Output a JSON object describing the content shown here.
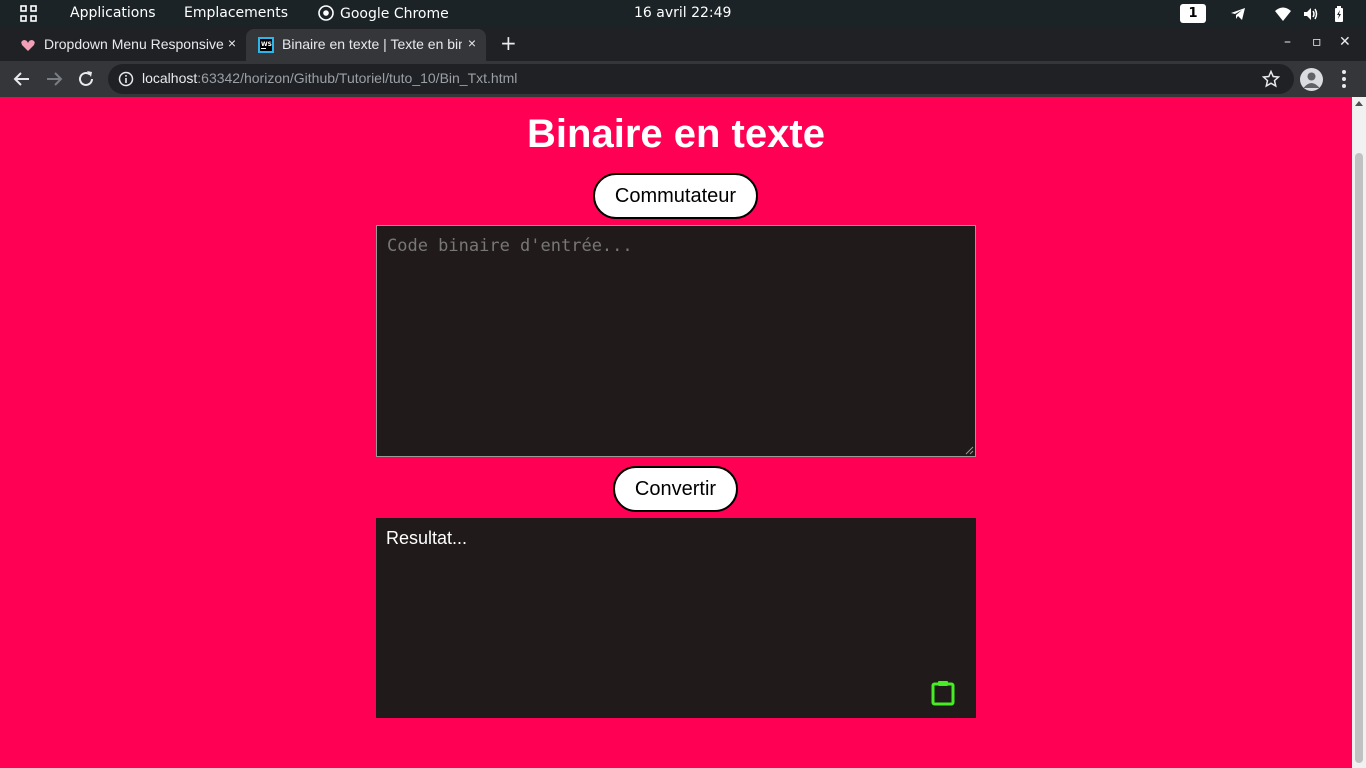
{
  "topbar": {
    "applications": "Applications",
    "places": "Emplacements",
    "active_app": "Google Chrome",
    "datetime": "16 avril  22:49",
    "workspace": "1"
  },
  "tabs": [
    {
      "title": "Dropdown Menu Responsive",
      "close": "×",
      "favicon": "heart-icon"
    },
    {
      "title": "Binaire en texte | Texte en binaire",
      "close": "×",
      "favicon": "webstorm-icon"
    }
  ],
  "new_tab": "+",
  "window_controls": {
    "minimize": "–",
    "maximize": "▫",
    "close": "✕"
  },
  "address_bar": {
    "host": "localhost",
    "path": ":63342/horizon/Github/Tutoriel/tuto_10/Bin_Txt.html"
  },
  "page": {
    "title": "Binaire en texte",
    "switch_button": "Commutateur",
    "input_placeholder": "Code binaire d'entrée...",
    "convert_button": "Convertir",
    "result_text": "Resultat..."
  },
  "colors": {
    "page_background": "#ff0055",
    "panel_background": "#211a1a",
    "copy_icon": "#44ee22"
  }
}
